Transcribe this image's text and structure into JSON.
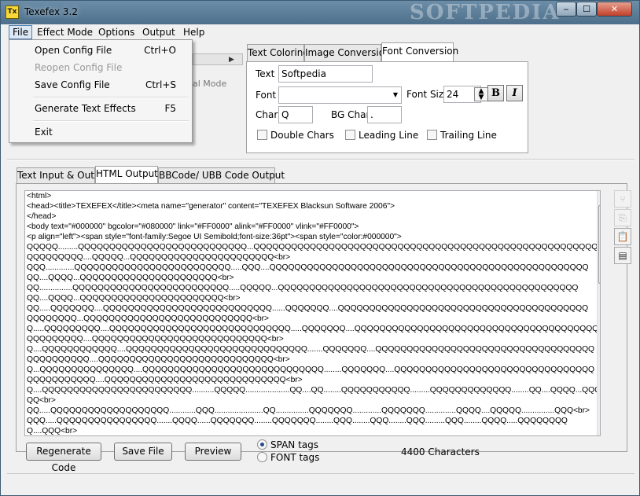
{
  "window": {
    "title": "Texefex 3.2",
    "icon_text": "Tx",
    "watermark": "SOFTPEDIA",
    "controls": {
      "minimize": "‒",
      "maximize": "☐",
      "close": "✕"
    }
  },
  "menubar": [
    "File",
    "Effect Mode",
    "Options",
    "Output",
    "Help"
  ],
  "file_menu": {
    "open": {
      "label": "Open Config File",
      "shortcut": "Ctrl+O"
    },
    "reopen": {
      "label": "Reopen Config File",
      "shortcut": ""
    },
    "save": {
      "label": "Save Config File",
      "shortcut": "Ctrl+S"
    },
    "generate": {
      "label": "Generate Text Effects",
      "shortcut": "F5"
    },
    "exit": {
      "label": "Exit",
      "shortcut": ""
    }
  },
  "partial": {
    "mode_label": "al Mode"
  },
  "top_tabs": [
    "Text Coloring",
    "Image Conversion",
    "Font Conversion"
  ],
  "font_conversion": {
    "text_label": "Text",
    "text_value": "Softpedia",
    "font_label": "Font",
    "font_value": "",
    "font_size_label": "Font Size",
    "font_size_value": "24",
    "bold": "B",
    "italic": "I",
    "char_label": "Char",
    "char_value": "Q",
    "bg_char_label": "BG Char",
    "bg_char_value": ".",
    "double_chars": "Double Chars",
    "leading_line": "Leading Line",
    "trailing_line": "Trailing Line"
  },
  "output_tabs": [
    "Text Input & Output",
    "HTML Output",
    "BBCode/ UBB Code Output"
  ],
  "html_output": [
    "<html>",
    "<head><title>TEXEFEX</title><meta name=\"generator\" content=\"TEXEFEX Blacksun Software 2006\">",
    "</head>",
    "<body text=\"#000000\" bgcolor=\"#080000\" link=\"#FF0000\" alink=\"#FF0000\" vlink=\"#FF0000\">",
    "<p align=\"left\"><span style=\"font-family:Segoe UI Semibold;font-size:36pt\"><span style=\"color:#000000\">",
    "QQQQQ.........QQQQQQQQQQQQQQQQQQQQQQQQQQQ...QQQQQQQQQQQQQQQQQQQQQQQQQQQQQQQQQQQQQQQQQQQQQQQQQQQQQQQQQ",
    "QQQQQQQQQ....QQQQQ...QQQQQQQQQQQQQQQQQQQQQQQ<br>",
    "QQQ.............QQQQQQQQQQQQQQQQQQQQQQQQQ.....QQQ....QQQQQQQQQQQQQQQQQQQQQQQQQQQQQQQQQQQQQQQQQQQQQQQQQQQ",
    "QQ....QQQQ...QQQQQQQQQQQQQQQQQQQQQQ<br>",
    "QQ...............QQQQQQQQQQQQQQQQQQQQQQQQQ.....QQQQQ...QQQQQQQQQQQQQQQQQQQQQQQQQQQQQQQQQQQQQQQQQQQQQQQQ",
    "QQ....QQQQ...QQQQQQQQQQQQQQQQQQQQQQQ<br>",
    "QQ.....QQQQQQQ....QQQQQQQQQQQQQQQQQQQQQQQQQQQ......QQQQQQQ....QQQQQQQQQQQQQQQQQQQQQQQQQQQQQQQQQQQQQQQQ",
    "QQQQQQQQ...QQQQQQQQQQQQQQQQQQQQQQQQQQQ<br>",
    "Q.....QQQQQQQQQ....QQQQQQQQQQQQQQQQQQQQQQQQQQQQQ.....QQQQQQQ....QQQQQQQQQQQQQQQQQQQQQQQQQQQQQQQQQQQQQQQ",
    "QQQQQQQQQ....QQQQQQQQQQQQQQQQQQQQQQQQQQQQ<br>",
    "Q....QQQQQQQQQQQQ....QQQQQQQQQQQQQQQQQQQQQQQQQQQQQ.......QQQQQQQ....QQQQQQQQQQQQQQQQQQQQQQQQQQQQQQQQQQQ",
    "QQQQQQQQQQ....QQQQQQQQQQQQQQQQQQQQQQQQQQQQ<br>",
    "Q...QQQQQQQQQQQQQQQ....QQQQQQQQQQQQQQQQQQQQQQQQQQQQQ........QQQQQQQ....QQQQQQQQQQQQQQQQQQQQQQQQQQQQQQQQ",
    "QQQQQQQQQQQ....QQQQQQQQQQQQQQQQQQQQQQQQQQQQQ<br>",
    "Q....QQQQQQQQQQQQQQQQQQQQQQQQ..........QQQQQ....................QQ....QQ........QQQQQQQQQQQ.........QQQQQQQQQQQQQ........QQ....QQQQ...QQQQQQQQQ........Q QQQQ",
    "QQ<br>",
    "QQ.....QQQQQQQQQQQQQQQQQQQ............QQQ......................QQ...............QQQQQQQ.............QQQQQQQ..............QQQQ....QQQQQ...............QQQ<br>",
    "QQQ.....QQQQQQQQQQQQQQQQ.......QQQQ......QQQQQQQ........QQQQQQQ........QQQ........QQQ........QQQ.........QQQ........QQQQ.....QQQQQQQQ",
    "Q....QQQ<br>"
  ],
  "buttons": {
    "regenerate": "Regenerate Code",
    "save_file": "Save File",
    "preview": "Preview"
  },
  "radios": {
    "span": "SPAN tags",
    "font": "FONT tags"
  },
  "char_count": "4400 Characters",
  "side_tools": [
    "⑂",
    "⎘",
    "📋",
    "▤"
  ]
}
